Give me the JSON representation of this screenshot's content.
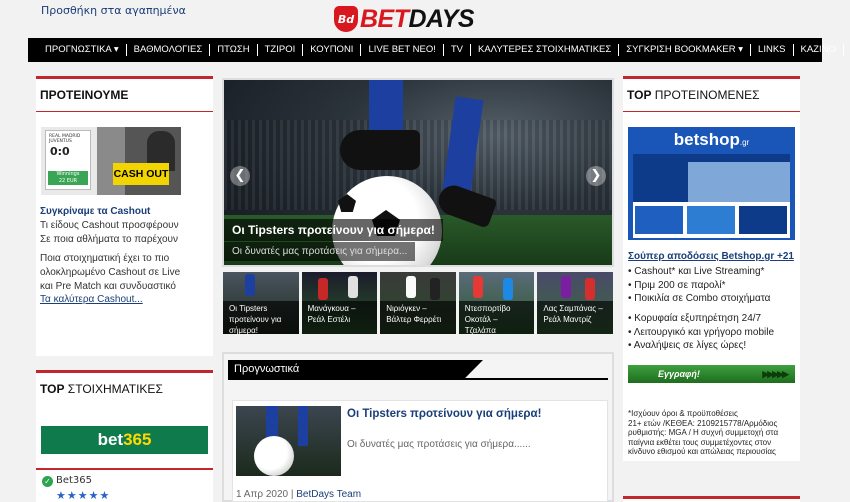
{
  "header": {
    "favorites_link": "Προσθήκη στα αγαπημένα",
    "logo_badge": "Bd",
    "logo_bet": "BET",
    "logo_days": "DAYS"
  },
  "nav": {
    "items": [
      "ΠΡΟΓΝΩΣΤΙΚΑ ▾",
      "ΒΑΘΜΟΛΟΓΙΕΣ",
      "ΠΤΩΣΗ",
      "ΤΖΙΡΟΙ",
      "ΚΟΥΠΟΝΙ",
      "LIVE BET ΝΕΟ!",
      "TV",
      "ΚΑΛΥΤΕΡΕΣ ΣΤΟΙΧΗΜΑΤΙΚΕΣ",
      "ΣΥΓΚΡΙΣΗ BOOKMAKER ▾",
      "LINKS",
      "ΚΑΖΙΝΟ"
    ]
  },
  "left_featured": {
    "title": "ΠΡΟΤΕΙΝΟΥΜΕ",
    "image_text": {
      "teams": "REAL MADRID\nJUVENTUS",
      "score": "0:0",
      "winnings": "Winnings\n22 EUR",
      "button": "CASH OUT"
    },
    "link": "Συγκρίναμε τα Cashout",
    "line1": "Τι είδους Cashout προσφέρουν",
    "line2": "Σε ποια αθλήματα το παρέχουν",
    "line3": "Ποια στοιχηματική έχει το πιο",
    "line4": "ολοκληρωμένο Cashout σε Live",
    "line5": "και Pre Match και συνδυαστικό",
    "link2": "Τα καλύτερα Cashout..."
  },
  "left_top": {
    "title_bold": "TOP",
    "title_rest": " ΣΤΟΙΧΗΜΑΤΙΚΕΣ",
    "banner_main": "bet",
    "banner_num": "365",
    "bookmaker": "Bet365",
    "rating": 5,
    "stars": "★★★★★"
  },
  "slider": {
    "title": "Οι Tipsters προτείνουν για σήμερα!",
    "subtitle": "Οι δυνατές μας προτάσεις για σήμερα...",
    "prev": "❮",
    "next": "❯"
  },
  "thumbs": [
    {
      "caption": "Οι Tipsters προτείνουν για σήμερα!"
    },
    {
      "caption": "Μανάγκουα – Ρεάλ Εστέλι"
    },
    {
      "caption": "Νιριόγκεν – Βάλτερ Φερρέτι"
    },
    {
      "caption": "Ντεσπορτίβο Οκοτάλ – Τζαλάπα"
    },
    {
      "caption": "Λας Σαμπάνας – Ρεάλ Μαντρίζ"
    }
  ],
  "predictions": {
    "heading": "Προγνωστικά",
    "article_title": "Οι Tipsters προτείνουν για σήμερα!",
    "article_excerpt": "Οι δυνατές μας προτάσεις για σήμερα......",
    "date": "1 Απρ 2020",
    "separator": " | ",
    "author": "BetDays Team"
  },
  "right_top": {
    "title_bold": "TOP",
    "title_rest": " ΠΡΟΤΕΙΝΟΜΕΝΕΣ",
    "banner_logo": "betshop",
    "banner_logo_suffix": ".gr",
    "link": "Σούπερ αποδόσεις Betshop.gr +21",
    "features1": [
      "• Cashout* και Live Streaming*",
      "• Πριμ 200 σε παρολί*",
      "• Ποικιλία σε Combo στοιχήματα"
    ],
    "features2": [
      "• Κορυφαία εξυπηρέτηση 24/7",
      "• Λειτουργικό και γρήγορο mobile",
      "• Αναλήψεις σε λίγες ώρες!"
    ],
    "register_button": "Εγγραφή!",
    "register_arrows": "▶▶▶▶▶",
    "terms": "*Ισχύουν όροι & προϋποθέσεις\n21+ ετών /ΚΕΘΕΑ: 2109215778/Αρμόδιος ρυθμιστής: MGA / Η συχνή συμμετοχή στα παίγνια εκθέτει τους συμμετέχοντες στον κίνδυνο εθισμού και απώλειας περιουσίας"
  },
  "colors": {
    "brand_red": "#d8181e",
    "nav_bg": "#000000",
    "link_blue": "#1a3e7a",
    "bet365_green": "#0f7a4b",
    "betshop_blue": "#1a56b8"
  }
}
